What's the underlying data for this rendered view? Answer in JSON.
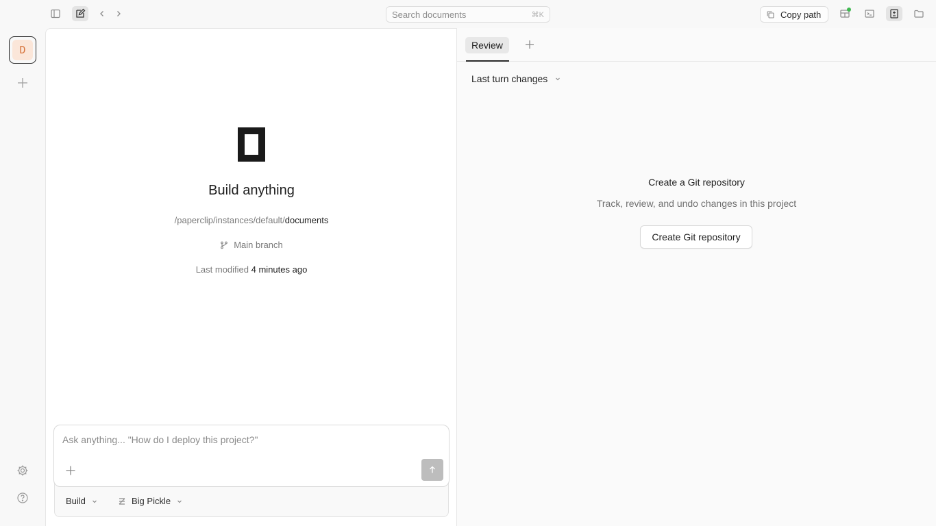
{
  "topbar": {
    "search_placeholder": "Search documents",
    "search_shortcut": "⌘K",
    "copy_path_label": "Copy path"
  },
  "rail": {
    "project_initial": "D"
  },
  "main": {
    "headline": "Build anything",
    "path_prefix": "/paperclip/instances/default/",
    "path_current": "documents",
    "branch": "Main branch",
    "modified_label": "Last modified",
    "modified_value": "4 minutes ago"
  },
  "composer": {
    "placeholder": "Ask anything... \"How do I deploy this project?\"",
    "mode": "Build",
    "model": "Big Pickle"
  },
  "review": {
    "tab_label": "Review",
    "changes_dropdown": "Last turn changes",
    "empty_title": "Create a Git repository",
    "empty_subtitle": "Track, review, and undo changes in this project",
    "create_button": "Create Git repository"
  },
  "colors": {
    "accent_status": "#3fb950",
    "avatar_bg": "#fbe6d9",
    "avatar_fg": "#d7743c"
  }
}
